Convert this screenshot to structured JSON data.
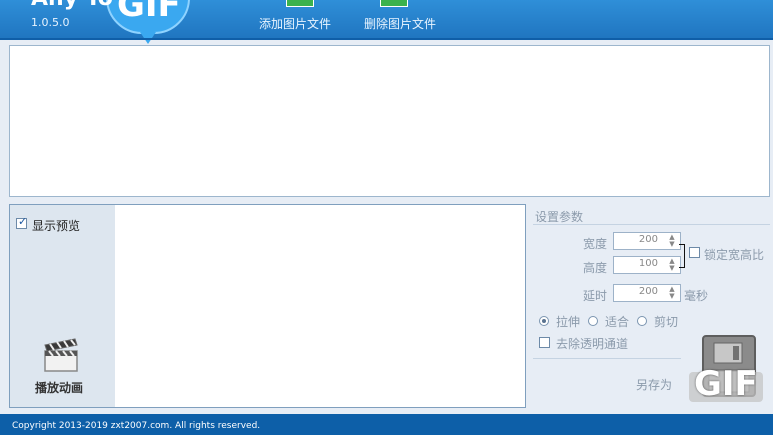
{
  "app": {
    "logo_text": "Any To",
    "logo_bubble": "GIF",
    "version": "1.0.5.0"
  },
  "toolbar": {
    "add_label": "添加图片文件",
    "delete_label": "删除图片文件"
  },
  "preview": {
    "show_preview_label": "显示预览",
    "show_preview_checked": true,
    "play_label": "播放动画"
  },
  "settings": {
    "title": "设置参数",
    "width_label": "宽度",
    "width_value": "200",
    "height_label": "高度",
    "height_value": "100",
    "lock_ratio_label": "锁定宽高比",
    "lock_ratio_checked": false,
    "delay_label": "延时",
    "delay_value": "200",
    "delay_unit": "毫秒",
    "mode_options": [
      "拉伸",
      "适合",
      "剪切"
    ],
    "selected_mode": "拉伸",
    "remove_transparency_label": "去除透明通道",
    "remove_transparency_checked": false,
    "save_as_label": "另存为",
    "save_icon_text": "GIF"
  },
  "footer": {
    "copyright": "Copyright 2013-2019 zxt2007.com. All rights reserved."
  },
  "colors": {
    "header": "#1f74bf",
    "footer": "#0d5fa8",
    "panel": "#dde6ef"
  }
}
